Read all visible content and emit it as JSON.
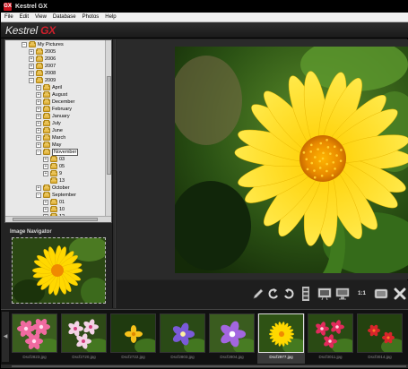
{
  "window": {
    "title": "Kestrel GX",
    "icon_text": "GX"
  },
  "menu": [
    {
      "label": "File"
    },
    {
      "label": "Edit"
    },
    {
      "label": "View"
    },
    {
      "label": "Database"
    },
    {
      "label": "Photos"
    },
    {
      "label": "Help"
    }
  ],
  "brand": {
    "name": "Kestrel",
    "suffix": "GX"
  },
  "tree": [
    {
      "label": "My Pictures",
      "depth": 0,
      "expander": "−"
    },
    {
      "label": "2005",
      "depth": 1,
      "expander": "+"
    },
    {
      "label": "2006",
      "depth": 1,
      "expander": "+"
    },
    {
      "label": "2007",
      "depth": 1,
      "expander": "+"
    },
    {
      "label": "2008",
      "depth": 1,
      "expander": "+"
    },
    {
      "label": "2009",
      "depth": 1,
      "expander": "−"
    },
    {
      "label": "April",
      "depth": 2,
      "expander": "+"
    },
    {
      "label": "August",
      "depth": 2,
      "expander": "+"
    },
    {
      "label": "December",
      "depth": 2,
      "expander": "+"
    },
    {
      "label": "February",
      "depth": 2,
      "expander": "+"
    },
    {
      "label": "January",
      "depth": 2,
      "expander": "+"
    },
    {
      "label": "July",
      "depth": 2,
      "expander": "+"
    },
    {
      "label": "June",
      "depth": 2,
      "expander": "+"
    },
    {
      "label": "March",
      "depth": 2,
      "expander": "+"
    },
    {
      "label": "May",
      "depth": 2,
      "expander": "+"
    },
    {
      "label": "November",
      "depth": 2,
      "expander": "−",
      "selected": true
    },
    {
      "label": "03",
      "depth": 3,
      "expander": "+"
    },
    {
      "label": "05",
      "depth": 3,
      "expander": "+"
    },
    {
      "label": "9",
      "depth": 3,
      "expander": "+"
    },
    {
      "label": "13",
      "depth": 3,
      "expander": ""
    },
    {
      "label": "October",
      "depth": 2,
      "expander": "+"
    },
    {
      "label": "September",
      "depth": 2,
      "expander": "−"
    },
    {
      "label": "01",
      "depth": 3,
      "expander": "+"
    },
    {
      "label": "10",
      "depth": 3,
      "expander": "+"
    },
    {
      "label": "12",
      "depth": 3,
      "expander": "+"
    }
  ],
  "navigator": {
    "title": "Image Navigator"
  },
  "toolbar": {
    "actual_size_label": "1:1",
    "tools": [
      "pencil-icon",
      "rotate-left-icon",
      "rotate-right-icon",
      "filmstrip-icon",
      "slideshow-icon",
      "monitor-icon",
      "actual-size-icon",
      "fullscreen-icon",
      "delete-icon"
    ]
  },
  "filmstrip": [
    {
      "filename": "Dscf2823.jpg",
      "flower": "pink"
    },
    {
      "filename": "Dscf2720.jpg",
      "flower": "white-pink"
    },
    {
      "filename": "Dscf2722.jpg",
      "flower": "yellow-bud"
    },
    {
      "filename": "Dscf2803.jpg",
      "flower": "purple"
    },
    {
      "filename": "Dscf2804.jpg",
      "flower": "violet"
    },
    {
      "filename": "Dscf2977.jpg",
      "flower": "yellow",
      "selected": true
    },
    {
      "filename": "Dscf3011.jpg",
      "flower": "red-pink"
    },
    {
      "filename": "Dscf3014.jpg",
      "flower": "red-spike"
    }
  ],
  "colors": {
    "accent": "#d21f2b",
    "flower_yellow": "#ffd400",
    "flower_center": "#f08a00",
    "foliage": "#2e5a17"
  }
}
